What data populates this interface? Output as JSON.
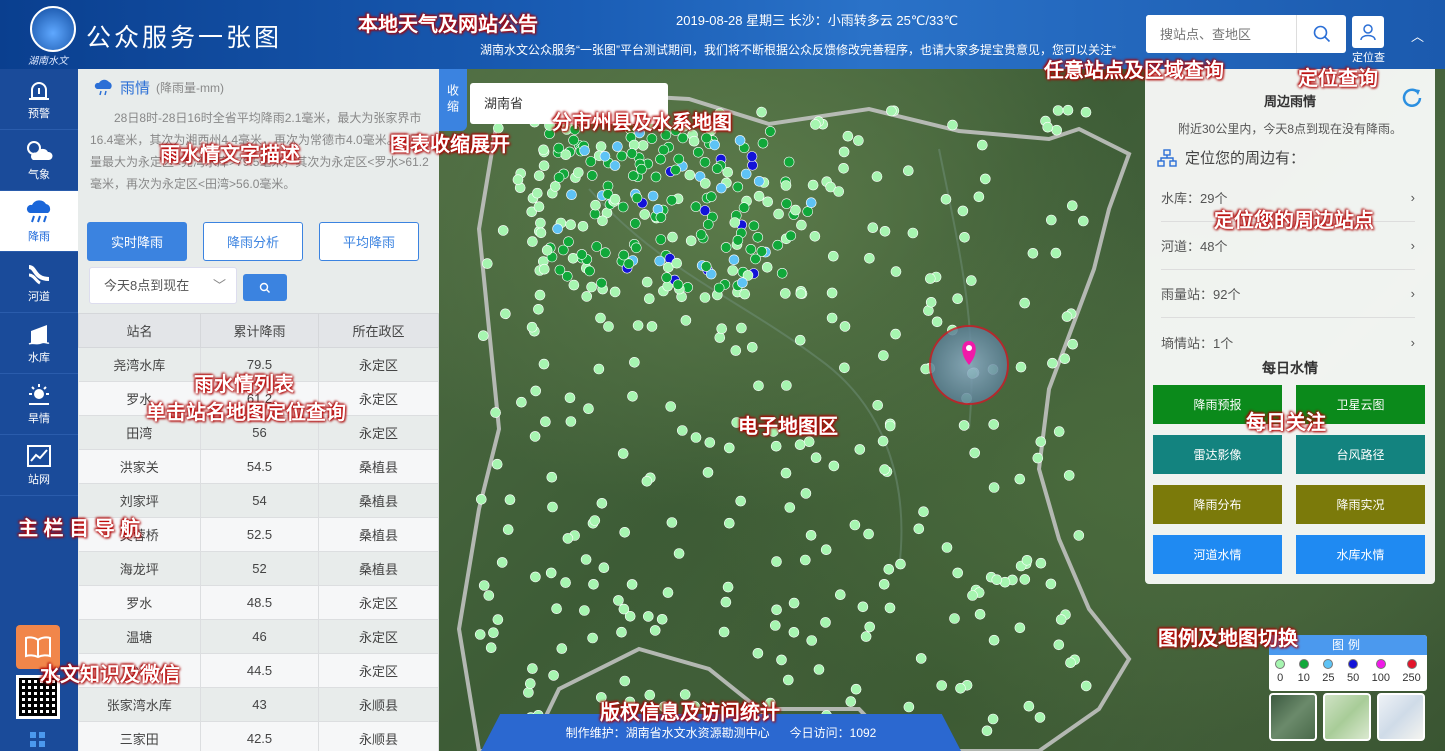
{
  "header": {
    "logo_text": "湖南水文",
    "title": "公众服务一张图",
    "weather": "2019-08-28 星期三 长沙：小雨转多云 25℃/33℃",
    "notice": "湖南水文公众服务“一张图”平台测试期间，我们将不断根据公众反馈修改完善程序，也请大家多提宝贵意见，您可以关注“",
    "search_placeholder": "搜站点、查地区",
    "locate_label": "定位查"
  },
  "nav": {
    "items": [
      {
        "label": "预警",
        "icon": "warning-icon"
      },
      {
        "label": "气象",
        "icon": "weather-icon"
      },
      {
        "label": "降雨",
        "icon": "rain-cloud-icon"
      },
      {
        "label": "河道",
        "icon": "river-icon"
      },
      {
        "label": "水库",
        "icon": "reservoir-icon"
      },
      {
        "label": "旱情",
        "icon": "sun-icon"
      },
      {
        "label": "站网",
        "icon": "chart-icon"
      }
    ],
    "active_index": 2
  },
  "panel": {
    "title": "雨情",
    "unit": "(降雨量-mm)",
    "description": "28日8时-28日16时全省平均降雨2.1毫米，最大为张家界市16.4毫米，其次为湘西州4.4毫米，再次为常德市4.0毫米。点雨量最大为永定区<尧湾水库>79.5毫米，其次为永定区<罗水>61.2毫米，再次为永定区<田湾>56.0毫米。",
    "tabs": [
      "实时降雨",
      "降雨分析",
      "平均降雨"
    ],
    "active_tab": 0,
    "period": "今天8点到现在",
    "columns": [
      "站名",
      "累计降雨",
      "所在政区"
    ],
    "rows": [
      [
        "尧湾水库",
        "79.5",
        "永定区"
      ],
      [
        "罗水",
        "61.2",
        "永定区"
      ],
      [
        "田湾",
        "56",
        "永定区"
      ],
      [
        "洪家关",
        "54.5",
        "桑植县"
      ],
      [
        "刘家坪",
        "54",
        "桑植县"
      ],
      [
        "芙蓉桥",
        "52.5",
        "桑植县"
      ],
      [
        "海龙坪",
        "52",
        "桑植县"
      ],
      [
        "罗水",
        "48.5",
        "永定区"
      ],
      [
        "温塘",
        "46",
        "永定区"
      ],
      [
        "沙堤",
        "44.5",
        "永定区"
      ],
      [
        "张家湾水库",
        "43",
        "永顺县"
      ],
      [
        "三家田",
        "42.5",
        "永顺县"
      ]
    ]
  },
  "map": {
    "collapse_label": "收缩",
    "region": "湖南省",
    "nearby": {
      "title": "周边雨情",
      "subtitle": "附近30公里内，今天8点到现在没有降雨。",
      "locate_title": "定位您的周边有：",
      "rows": [
        "水库：29个",
        "河道：48个",
        "雨量站：92个",
        "墒情站：1个"
      ]
    },
    "daily": {
      "title": "每日水情",
      "tiles": [
        {
          "label": "降雨预报",
          "color": "#0b8a1b"
        },
        {
          "label": "卫星云图",
          "color": "#0b8a1b"
        },
        {
          "label": "雷达影像",
          "color": "#13837f"
        },
        {
          "label": "台风路径",
          "color": "#13837f"
        },
        {
          "label": "降雨分布",
          "color": "#7b7a0a"
        },
        {
          "label": "降雨实况",
          "color": "#7b7a0a"
        },
        {
          "label": "河道水情",
          "color": "#1f8af2"
        },
        {
          "label": "水库水情",
          "color": "#1f8af2"
        }
      ]
    },
    "legend": {
      "title": "图例",
      "items": [
        {
          "label": "0",
          "color": "#a6f5b0"
        },
        {
          "label": "10",
          "color": "#11a83a"
        },
        {
          "label": "25",
          "color": "#5ec3f5"
        },
        {
          "label": "50",
          "color": "#1313d8"
        },
        {
          "label": "100",
          "color": "#f019e8"
        },
        {
          "label": "250",
          "color": "#e3142a"
        }
      ]
    }
  },
  "footer": {
    "maintainer": "制作维护：湖南省水文水资源勘测中心",
    "visits": "今日访问：1092"
  },
  "annotations": {
    "weather_notice": "本地天气及网站公告",
    "site_query": "任意站点及区域查询",
    "locate_query": "定位查询",
    "region_map": "分市州县及水系地图",
    "chart_toggle": "图表收缩展开",
    "text_desc": "雨水情文字描述",
    "nearby": "定位您的周边站点",
    "list": "雨水情列表",
    "list_hint": "单击站名地图定位查询",
    "map_area": "电子地图区",
    "daily": "每日关注",
    "nav": "主 栏 目 导 航",
    "knowledge": "水文知识及微信",
    "legend": "图例及地图切换",
    "copyright": "版权信息及访问统计"
  }
}
